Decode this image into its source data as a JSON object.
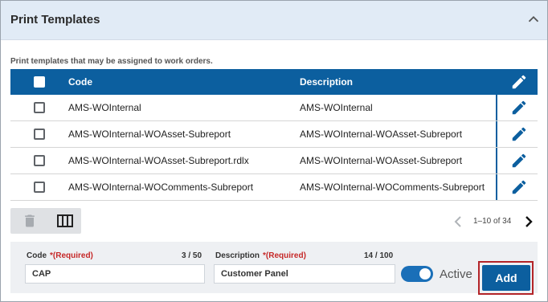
{
  "header": {
    "title": "Print Templates"
  },
  "subtitle": "Print templates that may be assigned to work orders.",
  "table": {
    "columns": {
      "code": "Code",
      "description": "Description"
    },
    "rows": [
      {
        "code": "AMS-WOInternal",
        "description": "AMS-WOInternal"
      },
      {
        "code": "AMS-WOInternal-WOAsset-Subreport",
        "description": "AMS-WOInternal-WOAsset-Subreport"
      },
      {
        "code": "AMS-WOInternal-WOAsset-Subreport.rdlx",
        "description": "AMS-WOInternal-WOAsset-Subreport"
      },
      {
        "code": "AMS-WOInternal-WOComments-Subreport",
        "description": "AMS-WOInternal-WOComments-Subreport"
      }
    ]
  },
  "pager": {
    "range": "1–10 of 34"
  },
  "form": {
    "code_label": "Code",
    "code_required": "*(Required)",
    "code_count": "3 / 50",
    "code_value": "CAP",
    "description_label": "Description",
    "description_required": "*(Required)",
    "description_count": "14 / 100",
    "description_value": "Customer Panel",
    "active_label": "Active",
    "active_on": true,
    "add_label": "Add"
  },
  "colors": {
    "accent": "#0c5f9f",
    "header_bg": "#e1ebf6",
    "required": "#c62828",
    "focus_outline": "#b32428"
  },
  "icons": [
    "chevron-up-icon",
    "pencil-icon",
    "trash-icon",
    "columns-icon",
    "chevron-left-icon",
    "chevron-right-icon"
  ]
}
